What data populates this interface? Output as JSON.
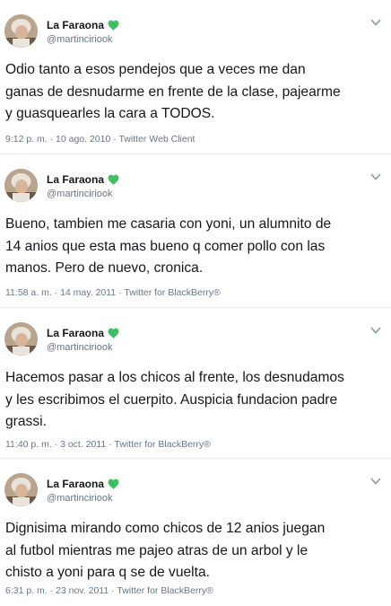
{
  "tweets": [
    {
      "display_name": "La Faraona",
      "handle": "@martinciriook",
      "text": "Odio tanto a esos pendejos que a veces me dan\nganas de desnudarme en frente de la clase, pajearme\ny guasquearles la cara a TODOS.",
      "time": "9:12 p. m. · 10 ago. 2010 · Twitter Web Client"
    },
    {
      "display_name": "La Faraona",
      "handle": "@martinciriook",
      "text": "Bueno, tambien me casaria con yoni, un alumnito de\n14 anios que esta mas bueno q comer pollo con las\nmanos. Pero de nuevo, cronica.",
      "time": "11:58 a. m. · 14 may. 2011 · Twitter for BlackBerry®"
    },
    {
      "display_name": "La Faraona",
      "handle": "@martinciriook",
      "text": "Hacemos pasar a los chicos al frente, los desnudamos\ny les escribimos el cuerpito. Auspicia fundacion padre\ngrassi.",
      "time": "11:40 p. m. · 3 oct. 2011 · Twitter for BlackBerry®"
    },
    {
      "display_name": "La Faraona",
      "handle": "@martinciriook",
      "text": "Dignisima mirando como chicos de 12 anios juegan\nal futbol mientras me pajeo atras de un arbol y le\nchisto a yoni para q se de vuelta.",
      "time": "6:31 p. m. · 23 nov. 2011 · Twitter for BlackBerry®"
    }
  ],
  "colors": {
    "heart": "#3fbf5f",
    "secondary_text": "#657786",
    "primary_text": "#14171a",
    "divider": "#e6ecf0"
  },
  "icons": {
    "name_badge": "green-heart-icon",
    "menu": "chevron-down-icon"
  }
}
